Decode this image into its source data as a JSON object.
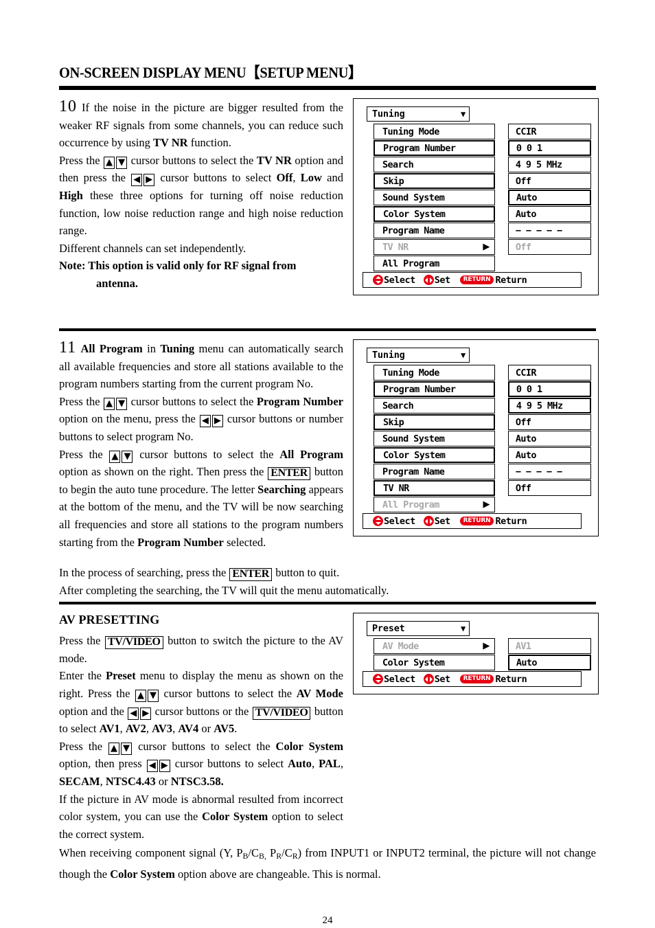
{
  "header": {
    "title": "ON-SCREEN DISPLAY MENU【SETUP MENU】"
  },
  "section10": {
    "number": "10",
    "p1_a": " If the noise in the picture are bigger resulted from the weaker RF signals from some channels, you can reduce such occurrence by using ",
    "p1_tvnr": "TV NR",
    "p1_b": " function.",
    "p2_a": "Press the ",
    "p2_up": "▲",
    "p2_down": "▼",
    "p2_b": " cursor buttons to select the ",
    "p2_tvnr": "TV NR",
    "p2_c": " option and then press the ",
    "p2_left": "◀",
    "p2_right": "▶",
    "p2_d": " cursor buttons to select ",
    "p2_off": "Off",
    "p2_comma": ", ",
    "p2_low": "Low",
    "p2_e": " and ",
    "p2_high": "High",
    "p2_f": " these three options for turning off noise reduction function, low noise reduction range and high noise reduction range.",
    "p3": "Different channels can set independently.",
    "note_label": "Note:",
    "note_text": " This option is valid only for RF signal from",
    "note_text2": "antenna."
  },
  "section11": {
    "number": "11",
    "p1_allprog": "All Program",
    "p1_a": " in ",
    "p1_tuning": "Tuning",
    "p1_b": " menu can automatically search all available frequencies and store all stations available to the program numbers starting from the current program No.",
    "p2_a": "Press the ",
    "p2_up": "▲",
    "p2_down": "▼",
    "p2_b": " cursor buttons to select the ",
    "p2_prognum": "Program Number",
    "p2_c": " option on the menu, press the ",
    "p2_left": "◀",
    "p2_right": "▶",
    "p2_d": " cursor buttons or number buttons to select program No.",
    "p3_a": "Press the ",
    "p3_up": "▲",
    "p3_down": "▼",
    "p3_b": " cursor buttons to select the ",
    "p3_allprog": "All Program",
    "p3_c": " option as shown on the right. Then press the ",
    "p3_enter": "ENTER",
    "p3_d": " button to begin the auto tune procedure. The letter ",
    "p3_searching": "Searching",
    "p3_e": " appears at the bottom of the menu, and the TV will be now searching all frequencies and store all stations to the program numbers starting from the ",
    "p3_prognum": "Program Number",
    "p3_f": " selected.",
    "p4_a": "In the process of searching, press the ",
    "p4_enter": "ENTER",
    "p4_b": " button to quit.",
    "p5": "After completing the searching, the TV will quit the menu automatically."
  },
  "av_presetting": {
    "heading": "AV PRESETTING",
    "p1_a": "Press the ",
    "p1_tvvideo": "TV/VIDEO",
    "p1_b": " button to switch the picture to the AV mode.",
    "p2_a": "Enter the ",
    "p2_preset": "Preset",
    "p2_b": " menu to display the menu as shown on the right. Press the ",
    "p2_up": "▲",
    "p2_down": "▼",
    "p2_c": " cursor buttons to select the ",
    "p2_avmode": "AV Mode",
    "p2_d": " option and the ",
    "p2_left": "◀",
    "p2_right": "▶",
    "p2_e": " cursor buttons or the ",
    "p2_tvvideo": "TV/VIDEO",
    "p2_f": " button to select ",
    "p2_av1": "AV1",
    "p2_av2": "AV2",
    "p2_av3": "AV3",
    "p2_av4": "AV4",
    "p2_g": " or ",
    "p2_av5": "AV5",
    "p2_h": ".",
    "p3_a": "Press the ",
    "p3_up": "▲",
    "p3_down": "▼",
    "p3_b": " cursor buttons to select the ",
    "p3_colorsys": "Color System",
    "p3_c": " option, then press ",
    "p3_left": "◀",
    "p3_right": "▶",
    "p3_d": " cursor buttons to select ",
    "p3_auto": "Auto",
    "p3_pal": "PAL",
    "p3_secam": "SECAM",
    "p3_ntsc443": "NTSC4.43",
    "p3_e": " or ",
    "p3_ntsc358": "NTSC3.58.",
    "p4_a": "If the picture in AV mode is abnormal resulted from incorrect color system, you can use the ",
    "p4_colorsys": "Color System",
    "p4_b": " option to select the correct system.",
    "p5_a": "When receiving component signal (Y, P",
    "p5_sub1": "B",
    "p5_b": "/C",
    "p5_sub2": "B,",
    "p5_c": " P",
    "p5_sub3": "R",
    "p5_d": "/C",
    "p5_sub4": "R",
    "p5_e": ") from INPUT1 or INPUT2 terminal, the picture will not change though the ",
    "p5_colorsys": "Color System",
    "p5_f": " option above are changeable. This is normal."
  },
  "osd_tuning_1": {
    "title": "Tuning",
    "caret": "▼",
    "rows": [
      {
        "label": "Tuning Mode",
        "value": "CCIR",
        "label_thick": false,
        "value_thick": false,
        "dim": false,
        "arrow": ""
      },
      {
        "label": "Program Number",
        "value": "0 0 1",
        "label_thick": true,
        "value_thick": true,
        "dim": false,
        "arrow": ""
      },
      {
        "label": "Search",
        "value": "4 9 5 MHz",
        "label_thick": false,
        "value_thick": false,
        "dim": false,
        "arrow": ""
      },
      {
        "label": "Skip",
        "value": "Off",
        "label_thick": true,
        "value_thick": false,
        "dim": false,
        "arrow": ""
      },
      {
        "label": "Sound System",
        "value": "Auto",
        "label_thick": false,
        "value_thick": true,
        "dim": false,
        "arrow": ""
      },
      {
        "label": "Color System",
        "value": "Auto",
        "label_thick": true,
        "value_thick": false,
        "dim": false,
        "arrow": ""
      },
      {
        "label": "Program Name",
        "value": "− − − − −",
        "label_thick": false,
        "value_thick": false,
        "dim": false,
        "arrow": ""
      },
      {
        "label": "TV NR",
        "value": "Off",
        "label_thick": false,
        "value_thick": false,
        "dim": true,
        "arrow": "▶"
      },
      {
        "label": "All Program",
        "value": "",
        "label_thick": false,
        "value_thick": false,
        "dim": false,
        "arrow": ""
      }
    ],
    "legend": {
      "select": "Select",
      "set": "Set",
      "return_badge": "RETURN",
      "return": "Return"
    }
  },
  "osd_tuning_2": {
    "title": "Tuning",
    "caret": "▼",
    "rows": [
      {
        "label": "Tuning Mode",
        "value": "CCIR",
        "label_thick": false,
        "value_thick": false,
        "dim": false,
        "arrow": ""
      },
      {
        "label": "Program Number",
        "value": "0 0 1",
        "label_thick": true,
        "value_thick": true,
        "dim": false,
        "arrow": ""
      },
      {
        "label": "Search",
        "value": "4 9 5 MHz",
        "label_thick": false,
        "value_thick": true,
        "dim": false,
        "arrow": ""
      },
      {
        "label": "Skip",
        "value": "Off",
        "label_thick": true,
        "value_thick": false,
        "dim": false,
        "arrow": ""
      },
      {
        "label": "Sound System",
        "value": "Auto",
        "label_thick": false,
        "value_thick": false,
        "dim": false,
        "arrow": ""
      },
      {
        "label": "Color System",
        "value": "Auto",
        "label_thick": true,
        "value_thick": false,
        "dim": false,
        "arrow": ""
      },
      {
        "label": "Program Name",
        "value": "− − − − −",
        "label_thick": false,
        "value_thick": false,
        "dim": false,
        "arrow": ""
      },
      {
        "label": "TV NR",
        "value": "Off",
        "label_thick": true,
        "value_thick": false,
        "dim": false,
        "arrow": ""
      },
      {
        "label": "All Program",
        "value": "",
        "label_thick": false,
        "value_thick": false,
        "dim": true,
        "arrow": "▶"
      }
    ],
    "legend": {
      "select": "Select",
      "set": "Set",
      "return_badge": "RETURN",
      "return": "Return"
    }
  },
  "osd_preset": {
    "title": "Preset",
    "caret": "▼",
    "rows": [
      {
        "label": "AV Mode",
        "value": "AV1",
        "label_thick": false,
        "value_thick": false,
        "dim": true,
        "arrow": "▶"
      },
      {
        "label": "Color System",
        "value": "Auto",
        "label_thick": false,
        "value_thick": true,
        "dim": false,
        "arrow": ""
      }
    ],
    "legend": {
      "select": "Select",
      "set": "Set",
      "return_badge": "RETURN",
      "return": "Return"
    }
  },
  "footer": {
    "page_number": "24"
  },
  "colors": {
    "accent_red": "#e60012",
    "dim_gray": "#a6a6a6",
    "ink": "#000000"
  }
}
